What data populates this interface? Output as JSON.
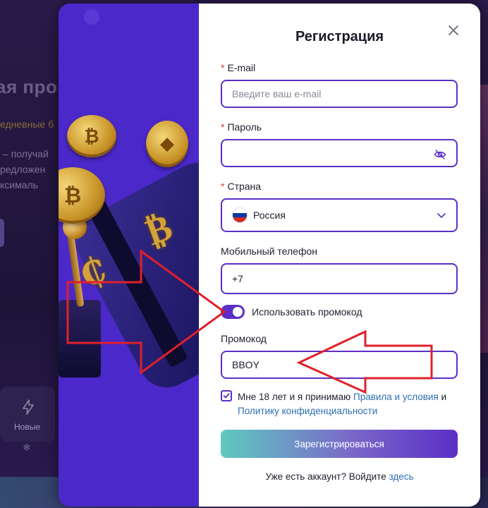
{
  "background": {
    "heading": "ая про",
    "subtitle": "едневные б",
    "lines": [
      "получай",
      "редложен",
      "ксималь"
    ],
    "tile_label": "Новые",
    "tile_icon": "lightning-icon",
    "snow_icon": "snowflake-icon"
  },
  "modal": {
    "title": "Регистрация",
    "close_icon": "close-icon",
    "email": {
      "label": "E-mail",
      "placeholder": "Введите ваш e-mail",
      "value": ""
    },
    "password": {
      "label": "Пароль",
      "value": "",
      "icon": "eye-off-icon"
    },
    "country": {
      "label": "Страна",
      "value": "Россия",
      "flag_colors": [
        "#ffffff",
        "#0039a6",
        "#d52b1e"
      ]
    },
    "phone": {
      "label": "Мобильный телефон",
      "value": "+7"
    },
    "promo_toggle": {
      "label": "Использовать промокод",
      "on": true
    },
    "promo": {
      "label": "Промокод",
      "value": "BBOY"
    },
    "terms": {
      "checked": true,
      "text_before": "Мне 18 лет и я принимаю ",
      "terms_link": "Правила и условия",
      "text_and": " и",
      "privacy_link": "Политику конфиденциальности"
    },
    "submit_label": "Зарегистрироваться",
    "login_prompt": "Уже есть аккаунт? Войдите ",
    "login_link": "здесь"
  },
  "colors": {
    "accent": "#5b2fc6",
    "promo_panel": "#4b28c9",
    "annotation": "#e0202a",
    "link": "#2c6fb0"
  }
}
